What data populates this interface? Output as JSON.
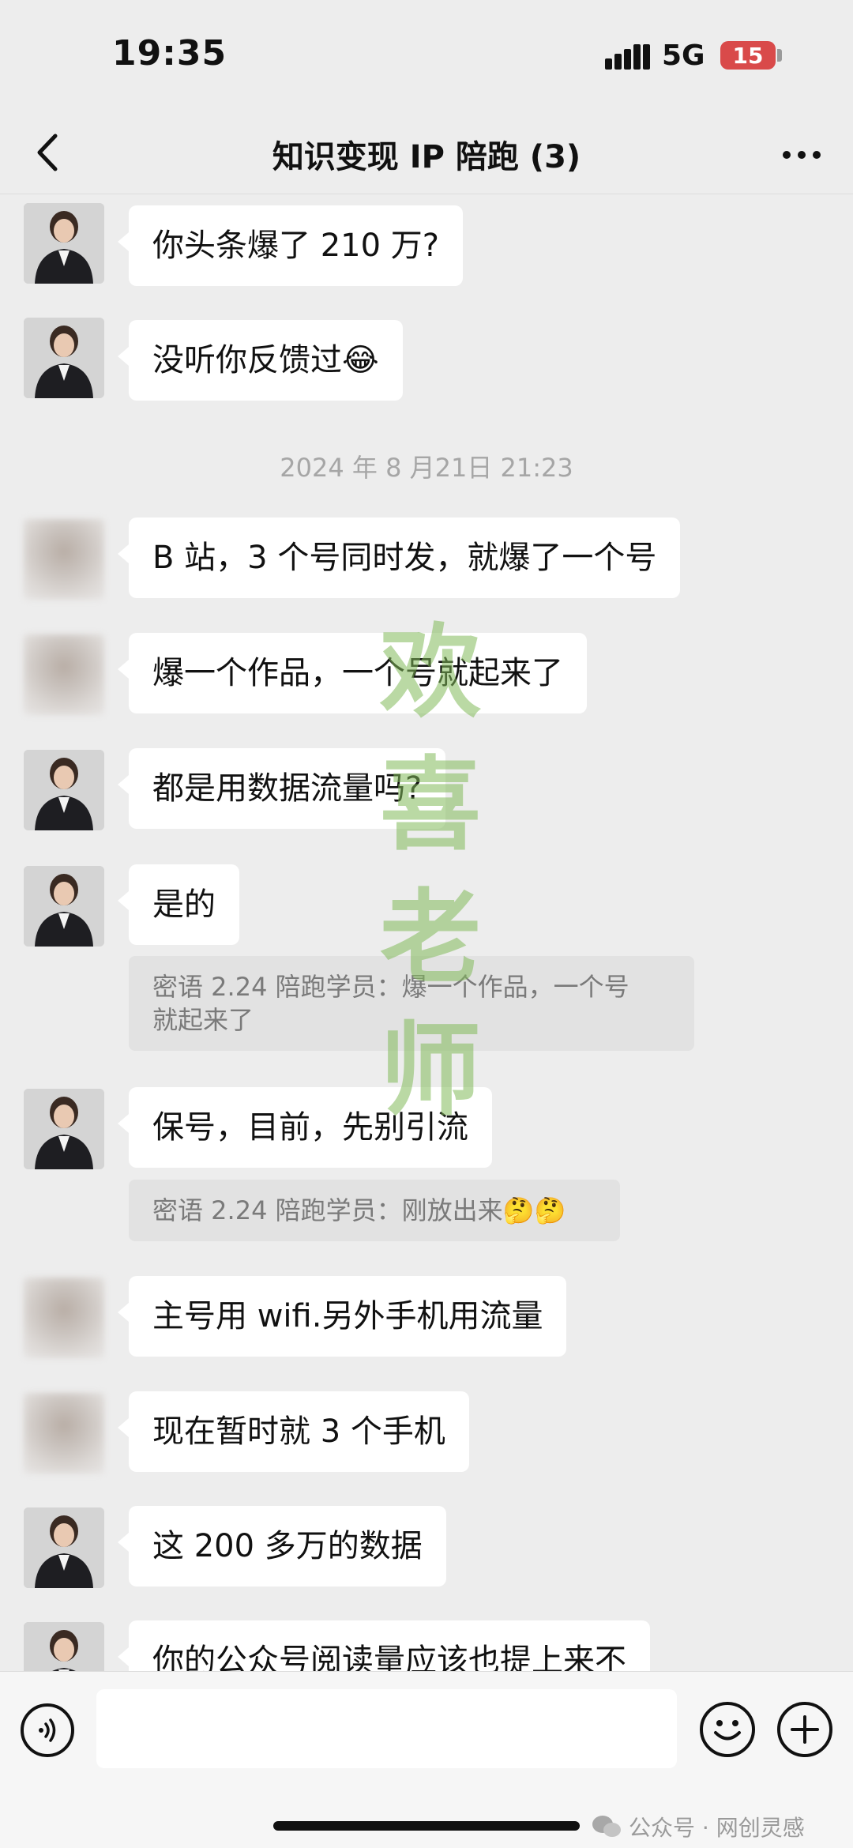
{
  "status_bar": {
    "time": "19:35",
    "network": "5G",
    "battery": "15"
  },
  "nav": {
    "title": "知识变现 IP 陪跑 (3)",
    "back_icon": "chevron-left-icon",
    "more_icon": "more-dots-icon"
  },
  "chat": {
    "messages": [
      {
        "text": "你头条爆了 210 万?"
      },
      {
        "text": "没听你反馈过😂"
      },
      {
        "text": "B 站，3 个号同时发，就爆了一个号"
      },
      {
        "text": "爆一个作品，一个号就起来了"
      },
      {
        "text": "都是用数据流量吗?"
      },
      {
        "text": "是的"
      },
      {
        "text": "保号，目前，先别引流"
      },
      {
        "text": "主号用 wifi.另外手机用流量"
      },
      {
        "text": "现在暂时就 3 个手机"
      },
      {
        "text": "这 200 多万的数据"
      },
      {
        "text": "你的公众号阅读量应该也提上来不"
      }
    ],
    "time_divider": "2024 年 8 月21日 21:23",
    "quotes": [
      {
        "line1": "密语 2.24 陪跑学员：爆一个作品，一个号",
        "line2": "就起来了"
      },
      {
        "text": "密语 2.24 陪跑学员：刚放出来🤔🤔"
      }
    ]
  },
  "watermark": [
    "欢",
    "喜",
    "老",
    "师"
  ],
  "input_bar": {
    "voice_icon": "voice-icon",
    "emoji_icon": "emoji-icon",
    "plus_icon": "plus-icon",
    "source_text": "公众号 · 网创灵感"
  }
}
